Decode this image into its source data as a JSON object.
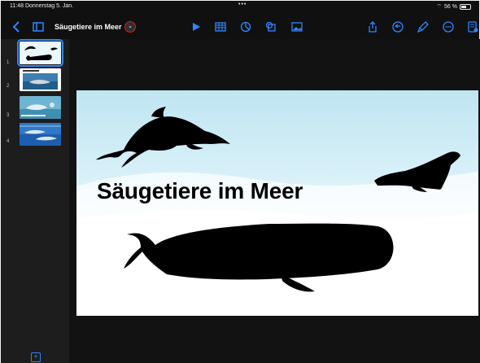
{
  "status_bar": {
    "time": "11:48",
    "date": "Donnerstag 5. Jan.",
    "dots": "•••",
    "battery": "56 %"
  },
  "toolbar": {
    "title": "Säugetiere im Meer",
    "title_menu_icon": "chevron-down-icon",
    "accent_color": "#2f86ff"
  },
  "slides": [
    {
      "number": "1",
      "thumb_text": "Säugetiere im Meer"
    },
    {
      "number": "2",
      "thumb_text": ""
    },
    {
      "number": "3",
      "thumb_text": ""
    },
    {
      "number": "4",
      "thumb_text": ""
    }
  ],
  "slide": {
    "title": "Säugetiere im Meer",
    "background": "#d8f0f8"
  }
}
